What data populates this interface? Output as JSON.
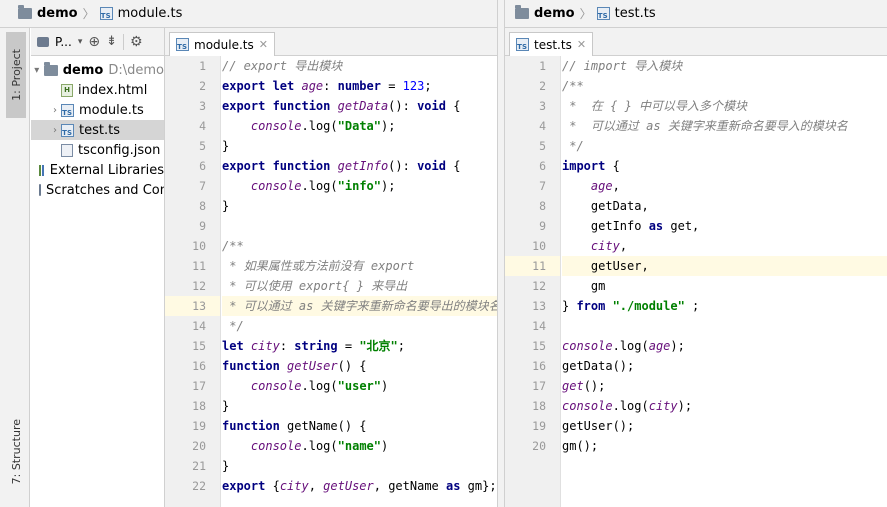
{
  "left_strip": {
    "project_tab": "1: Project",
    "structure_tab": "7: Structure"
  },
  "left_crumb": {
    "project": "demo",
    "file": "module.ts"
  },
  "right_crumb": {
    "project": "demo",
    "file": "test.ts"
  },
  "project_panel": {
    "title": "P...",
    "tree": {
      "root": {
        "name": "demo",
        "path": "D:\\demo"
      },
      "files": [
        "index.html",
        "module.ts",
        "test.ts",
        "tsconfig.json"
      ],
      "external": "External Libraries",
      "scratches": "Scratches and Consoles"
    }
  },
  "left_editor": {
    "tab": "module.ts",
    "highlight_line": 13,
    "lines": [
      [
        {
          "t": "cm",
          "v": "// export 导出模块"
        }
      ],
      [
        {
          "t": "kw",
          "v": "export let "
        },
        {
          "t": "va",
          "v": "age"
        },
        {
          "t": "pl",
          "v": ": "
        },
        {
          "t": "kw",
          "v": "number"
        },
        {
          "t": "pl",
          "v": " = "
        },
        {
          "t": "nm",
          "v": "123"
        },
        {
          "t": "pl",
          "v": ";"
        }
      ],
      [
        {
          "t": "kw",
          "v": "export function "
        },
        {
          "t": "va",
          "v": "getData"
        },
        {
          "t": "pl",
          "v": "(): "
        },
        {
          "t": "kw",
          "v": "void"
        },
        {
          "t": "pl",
          "v": " {"
        }
      ],
      [
        {
          "t": "pl",
          "v": "    "
        },
        {
          "t": "pp",
          "v": "console"
        },
        {
          "t": "pl",
          "v": "."
        },
        {
          "t": "fn",
          "v": "log"
        },
        {
          "t": "pl",
          "v": "("
        },
        {
          "t": "st",
          "v": "\"Data\""
        },
        {
          "t": "pl",
          "v": ");"
        }
      ],
      [
        {
          "t": "pl",
          "v": "}"
        }
      ],
      [
        {
          "t": "kw",
          "v": "export function "
        },
        {
          "t": "va",
          "v": "getInfo"
        },
        {
          "t": "pl",
          "v": "(): "
        },
        {
          "t": "kw",
          "v": "void"
        },
        {
          "t": "pl",
          "v": " {"
        }
      ],
      [
        {
          "t": "pl",
          "v": "    "
        },
        {
          "t": "pp",
          "v": "console"
        },
        {
          "t": "pl",
          "v": "."
        },
        {
          "t": "fn",
          "v": "log"
        },
        {
          "t": "pl",
          "v": "("
        },
        {
          "t": "st",
          "v": "\"info\""
        },
        {
          "t": "pl",
          "v": ");"
        }
      ],
      [
        {
          "t": "pl",
          "v": "}"
        }
      ],
      [],
      [
        {
          "t": "cm",
          "v": "/**"
        }
      ],
      [
        {
          "t": "cm",
          "v": " * 如果属性或方法前没有 export"
        }
      ],
      [
        {
          "t": "cm",
          "v": " * 可以使用 export{ } 来导出"
        }
      ],
      [
        {
          "t": "cm",
          "v": " * 可以通过 as 关键字来重新命名要导出的模块名"
        }
      ],
      [
        {
          "t": "cm",
          "v": " */"
        }
      ],
      [
        {
          "t": "kw",
          "v": "let "
        },
        {
          "t": "va",
          "v": "city"
        },
        {
          "t": "pl",
          "v": ": "
        },
        {
          "t": "kw",
          "v": "string"
        },
        {
          "t": "pl",
          "v": " = "
        },
        {
          "t": "st",
          "v": "\"北京\""
        },
        {
          "t": "pl",
          "v": ";"
        }
      ],
      [
        {
          "t": "kw",
          "v": "function "
        },
        {
          "t": "va",
          "v": "getUser"
        },
        {
          "t": "pl",
          "v": "() {"
        }
      ],
      [
        {
          "t": "pl",
          "v": "    "
        },
        {
          "t": "pp",
          "v": "console"
        },
        {
          "t": "pl",
          "v": "."
        },
        {
          "t": "fn",
          "v": "log"
        },
        {
          "t": "pl",
          "v": "("
        },
        {
          "t": "st",
          "v": "\"user\""
        },
        {
          "t": "pl",
          "v": ")"
        }
      ],
      [
        {
          "t": "pl",
          "v": "}"
        }
      ],
      [
        {
          "t": "kw",
          "v": "function "
        },
        {
          "t": "fn",
          "v": "getName"
        },
        {
          "t": "pl",
          "v": "() {"
        }
      ],
      [
        {
          "t": "pl",
          "v": "    "
        },
        {
          "t": "pp",
          "v": "console"
        },
        {
          "t": "pl",
          "v": "."
        },
        {
          "t": "fn",
          "v": "log"
        },
        {
          "t": "pl",
          "v": "("
        },
        {
          "t": "st",
          "v": "\"name\""
        },
        {
          "t": "pl",
          "v": ")"
        }
      ],
      [
        {
          "t": "pl",
          "v": "}"
        }
      ],
      [
        {
          "t": "kw",
          "v": "export "
        },
        {
          "t": "pl",
          "v": "{"
        },
        {
          "t": "va",
          "v": "city"
        },
        {
          "t": "pl",
          "v": ", "
        },
        {
          "t": "va",
          "v": "getUser"
        },
        {
          "t": "pl",
          "v": ", getName "
        },
        {
          "t": "kw",
          "v": "as"
        },
        {
          "t": "pl",
          "v": " gm};"
        }
      ]
    ]
  },
  "right_editor": {
    "tab": "test.ts",
    "highlight_line": 11,
    "lines": [
      [
        {
          "t": "cm",
          "v": "// import 导入模块"
        }
      ],
      [
        {
          "t": "cm",
          "v": "/**"
        }
      ],
      [
        {
          "t": "cm",
          "v": " *  在 { } 中可以导入多个模块"
        }
      ],
      [
        {
          "t": "cm",
          "v": " *  可以通过 as 关键字来重新命名要导入的模块名"
        }
      ],
      [
        {
          "t": "cm",
          "v": " */"
        }
      ],
      [
        {
          "t": "kw",
          "v": "import "
        },
        {
          "t": "pl",
          "v": "{"
        }
      ],
      [
        {
          "t": "pl",
          "v": "    "
        },
        {
          "t": "va",
          "v": "age"
        },
        {
          "t": "pl",
          "v": ","
        }
      ],
      [
        {
          "t": "pl",
          "v": "    getData,"
        }
      ],
      [
        {
          "t": "pl",
          "v": "    getInfo "
        },
        {
          "t": "kw",
          "v": "as"
        },
        {
          "t": "pl",
          "v": " get,"
        }
      ],
      [
        {
          "t": "pl",
          "v": "    "
        },
        {
          "t": "va",
          "v": "city"
        },
        {
          "t": "pl",
          "v": ","
        }
      ],
      [
        {
          "t": "pl",
          "v": "    getUser,"
        }
      ],
      [
        {
          "t": "pl",
          "v": "    gm"
        }
      ],
      [
        {
          "t": "pl",
          "v": "} "
        },
        {
          "t": "kw",
          "v": "from "
        },
        {
          "t": "st",
          "v": "\"./module\""
        },
        {
          "t": "pl",
          "v": " ;"
        }
      ],
      [],
      [
        {
          "t": "pp",
          "v": "console"
        },
        {
          "t": "pl",
          "v": "."
        },
        {
          "t": "fn",
          "v": "log"
        },
        {
          "t": "pl",
          "v": "("
        },
        {
          "t": "va",
          "v": "age"
        },
        {
          "t": "pl",
          "v": ");"
        }
      ],
      [
        {
          "t": "fn",
          "v": "getData"
        },
        {
          "t": "pl",
          "v": "();"
        }
      ],
      [
        {
          "t": "va",
          "v": "get"
        },
        {
          "t": "pl",
          "v": "();"
        }
      ],
      [
        {
          "t": "pp",
          "v": "console"
        },
        {
          "t": "pl",
          "v": "."
        },
        {
          "t": "fn",
          "v": "log"
        },
        {
          "t": "pl",
          "v": "("
        },
        {
          "t": "va",
          "v": "city"
        },
        {
          "t": "pl",
          "v": ");"
        }
      ],
      [
        {
          "t": "fn",
          "v": "getUser"
        },
        {
          "t": "pl",
          "v": "();"
        }
      ],
      [
        {
          "t": "fn",
          "v": "gm"
        },
        {
          "t": "pl",
          "v": "();"
        }
      ]
    ]
  }
}
